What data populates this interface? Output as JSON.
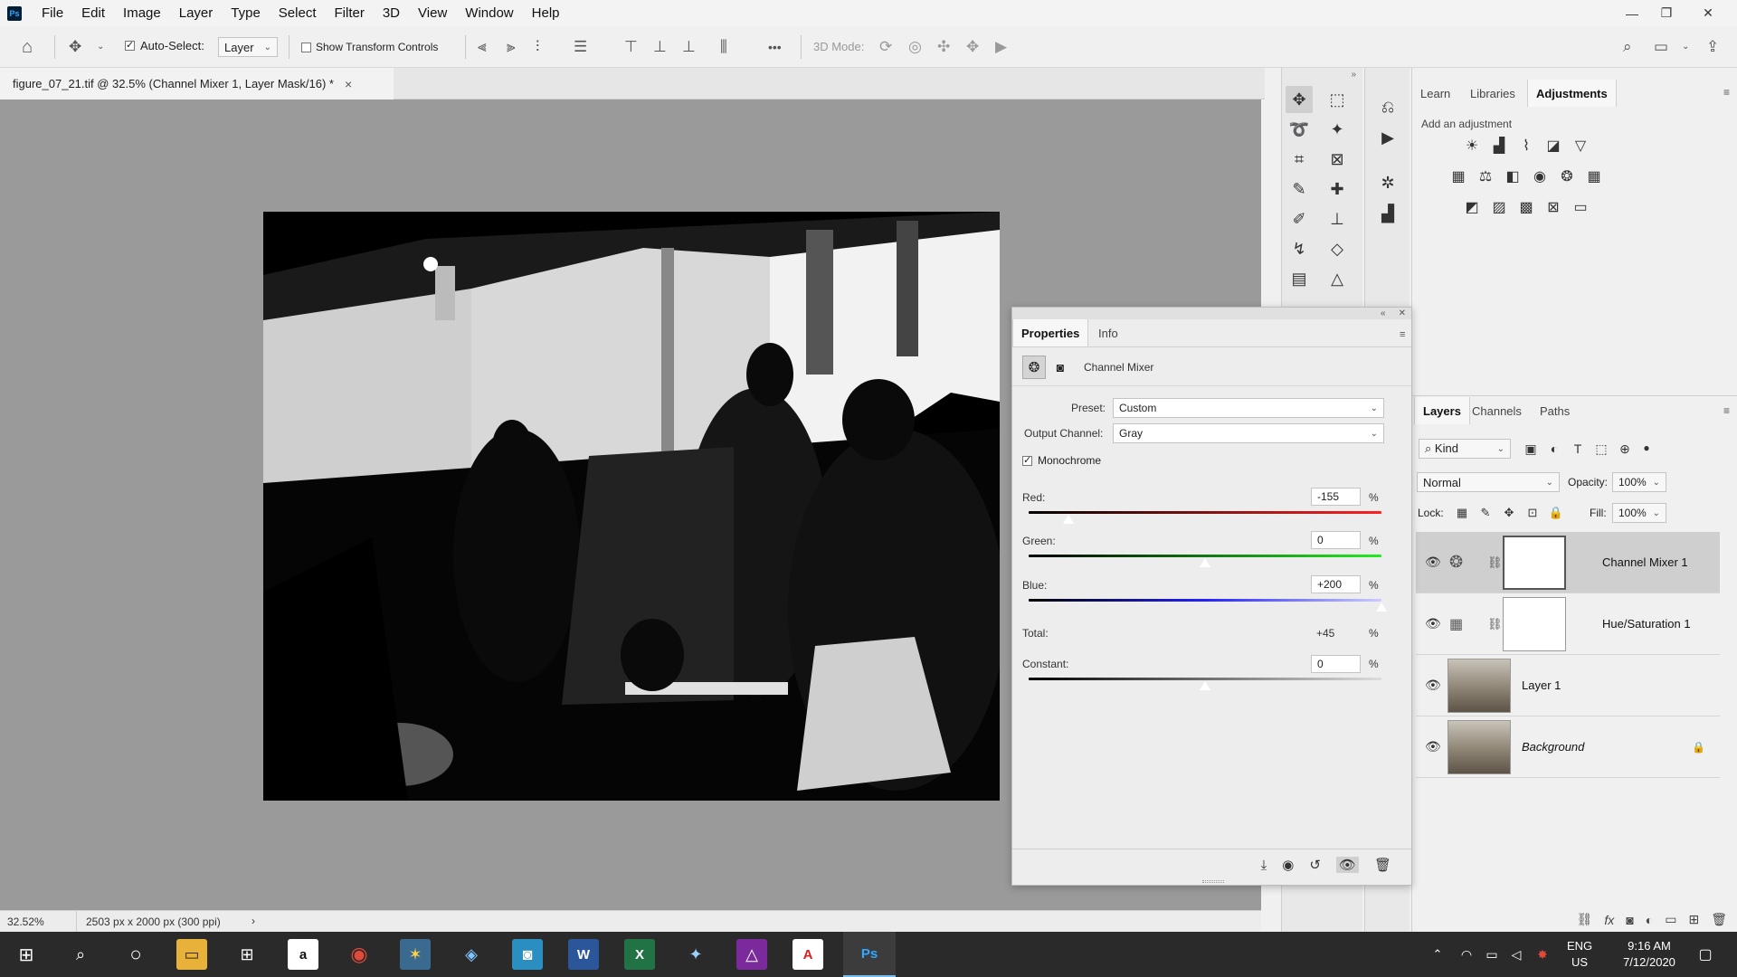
{
  "app": {
    "logo": "Ps",
    "menu": [
      "File",
      "Edit",
      "Image",
      "Layer",
      "Type",
      "Select",
      "Filter",
      "3D",
      "View",
      "Window",
      "Help"
    ]
  },
  "options_bar": {
    "auto_select_label": "Auto-Select:",
    "auto_select_checked": true,
    "auto_select_target": "Layer",
    "show_transform_label": "Show Transform Controls",
    "show_transform_checked": false,
    "mode_3d_label": "3D Mode:",
    "more_glyph": "•••"
  },
  "document": {
    "tab_title": "figure_07_21.tif @ 32.5% (Channel Mixer 1, Layer Mask/16) *",
    "close_glyph": "×"
  },
  "status_bar": {
    "zoom": "32.52%",
    "doc_info": "2503 px x 2000 px (300 ppi)",
    "arrow": "›"
  },
  "right_panel": {
    "tabs": [
      "Learn",
      "Libraries",
      "Adjustments"
    ],
    "active_tab": "Adjustments",
    "add_adjustment_label": "Add an adjustment",
    "adjustment_icons_row1": [
      "brightness-contrast-icon",
      "levels-icon",
      "curves-icon",
      "exposure-icon",
      "vibrance-icon"
    ],
    "adjustment_icons_row2": [
      "hue-saturation-icon",
      "color-balance-icon",
      "black-white-icon",
      "photo-filter-icon",
      "channel-mixer-icon",
      "color-lookup-icon"
    ],
    "adjustment_icons_row3": [
      "invert-icon",
      "posterize-icon",
      "threshold-icon",
      "selective-color-icon",
      "gradient-map-icon"
    ]
  },
  "properties": {
    "tabs": [
      "Properties",
      "Info"
    ],
    "active_tab": "Properties",
    "title": "Channel Mixer",
    "preset_label": "Preset:",
    "preset_value": "Custom",
    "output_channel_label": "Output Channel:",
    "output_channel_value": "Gray",
    "monochrome_label": "Monochrome",
    "monochrome_checked": true,
    "red_label": "Red:",
    "red_value": "-155",
    "green_label": "Green:",
    "green_value": "0",
    "blue_label": "Blue:",
    "blue_value": "+200",
    "total_label": "Total:",
    "total_value": "+45",
    "constant_label": "Constant:",
    "constant_value": "0",
    "percent": "%",
    "slider_min": -200,
    "slider_max": 200,
    "red_number": -155,
    "green_number": 0,
    "blue_number": 200,
    "constant_number": 0
  },
  "layers_panel": {
    "tabs": [
      "Layers",
      "Channels",
      "Paths"
    ],
    "active_tab": "Layers",
    "filter_kind": "Kind",
    "blend_mode": "Normal",
    "opacity_label": "Opacity:",
    "opacity_value": "100%",
    "lock_label": "Lock:",
    "fill_label": "Fill:",
    "fill_value": "100%",
    "layers": [
      {
        "name": "Channel Mixer 1",
        "selected": true,
        "type": "adjustment"
      },
      {
        "name": "Hue/Saturation 1",
        "selected": false,
        "type": "adjustment"
      },
      {
        "name": "Layer 1",
        "selected": false,
        "type": "pixel"
      },
      {
        "name": "Background",
        "selected": false,
        "type": "background",
        "locked": true
      }
    ]
  },
  "taskbar": {
    "time": "9:16 AM",
    "date": "7/12/2020",
    "lang": "ENG",
    "region": "US",
    "apps": [
      "start",
      "search",
      "task-view",
      "file-explorer",
      "store",
      "amazon",
      "chrome",
      "app-a",
      "app-b",
      "camera",
      "word",
      "excel",
      "app-c",
      "affinity",
      "pdf",
      "photoshop"
    ]
  },
  "colors": {
    "canvas_bg": "#9a9a9a",
    "panel_bg": "#f0f0f0",
    "taskbar_bg": "#2a2a2a",
    "ps_blue": "#31a8ff"
  }
}
